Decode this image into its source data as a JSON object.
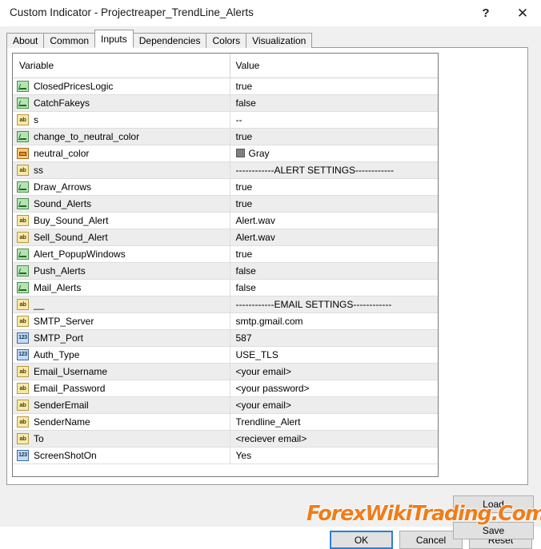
{
  "window": {
    "title": "Custom Indicator - Projectreaper_TrendLine_Alerts",
    "help_icon": "?",
    "close_icon": "✕"
  },
  "tabs": [
    {
      "label": "About",
      "active": false
    },
    {
      "label": "Common",
      "active": false
    },
    {
      "label": "Inputs",
      "active": true
    },
    {
      "label": "Dependencies",
      "active": false
    },
    {
      "label": "Colors",
      "active": false
    },
    {
      "label": "Visualization",
      "active": false
    }
  ],
  "table": {
    "headers": {
      "variable": "Variable",
      "value": "Value"
    },
    "rows": [
      {
        "icon": "bool-icon",
        "type": "bool",
        "name": "ClosedPricesLogic",
        "value": "true"
      },
      {
        "icon": "bool-icon",
        "type": "bool",
        "name": "CatchFakeys",
        "value": "false"
      },
      {
        "icon": "string-icon",
        "type": "str",
        "name": "s",
        "value": "--"
      },
      {
        "icon": "bool-icon",
        "type": "bool",
        "name": "change_to_neutral_color",
        "value": "true"
      },
      {
        "icon": "color-icon",
        "type": "color",
        "name": "neutral_color",
        "value": "Gray",
        "swatch": "#808080"
      },
      {
        "icon": "string-icon",
        "type": "str",
        "name": "ss",
        "value": "------------ALERT SETTINGS------------"
      },
      {
        "icon": "bool-icon",
        "type": "bool",
        "name": "Draw_Arrows",
        "value": "true"
      },
      {
        "icon": "bool-icon",
        "type": "bool",
        "name": "Sound_Alerts",
        "value": "true"
      },
      {
        "icon": "string-icon",
        "type": "str",
        "name": "Buy_Sound_Alert",
        "value": "Alert.wav"
      },
      {
        "icon": "string-icon",
        "type": "str",
        "name": "Sell_Sound_Alert",
        "value": "Alert.wav"
      },
      {
        "icon": "bool-icon",
        "type": "bool",
        "name": "Alert_PopupWindows",
        "value": "true"
      },
      {
        "icon": "bool-icon",
        "type": "bool",
        "name": "Push_Alerts",
        "value": "false"
      },
      {
        "icon": "bool-icon",
        "type": "bool",
        "name": "Mail_Alerts",
        "value": "false"
      },
      {
        "icon": "string-icon",
        "type": "str",
        "name": "__",
        "value": "------------EMAIL SETTINGS------------"
      },
      {
        "icon": "string-icon",
        "type": "str",
        "name": "SMTP_Server",
        "value": "smtp.gmail.com"
      },
      {
        "icon": "number-icon",
        "type": "num",
        "name": "SMTP_Port",
        "value": "587"
      },
      {
        "icon": "number-icon",
        "type": "num",
        "name": "Auth_Type",
        "value": "USE_TLS"
      },
      {
        "icon": "string-icon",
        "type": "str",
        "name": "Email_Username",
        "value": "<your email>"
      },
      {
        "icon": "string-icon",
        "type": "str",
        "name": "Email_Password",
        "value": "<your password>"
      },
      {
        "icon": "string-icon",
        "type": "str",
        "name": "SenderEmail",
        "value": "<your email>"
      },
      {
        "icon": "string-icon",
        "type": "str",
        "name": "SenderName",
        "value": "Trendline_Alert"
      },
      {
        "icon": "string-icon",
        "type": "str",
        "name": "To",
        "value": "<reciever email>"
      },
      {
        "icon": "number-icon",
        "type": "num",
        "name": "ScreenShotOn",
        "value": "Yes"
      }
    ]
  },
  "side_buttons": {
    "load": "Load",
    "save": "Save"
  },
  "bottom_buttons": {
    "ok": "OK",
    "cancel": "Cancel",
    "reset": "Reset"
  },
  "watermark": {
    "text": "ForexWikiTrading.Com",
    "color": "#f07d1a"
  },
  "icon_labels": {
    "string": "ab",
    "number": "123"
  }
}
